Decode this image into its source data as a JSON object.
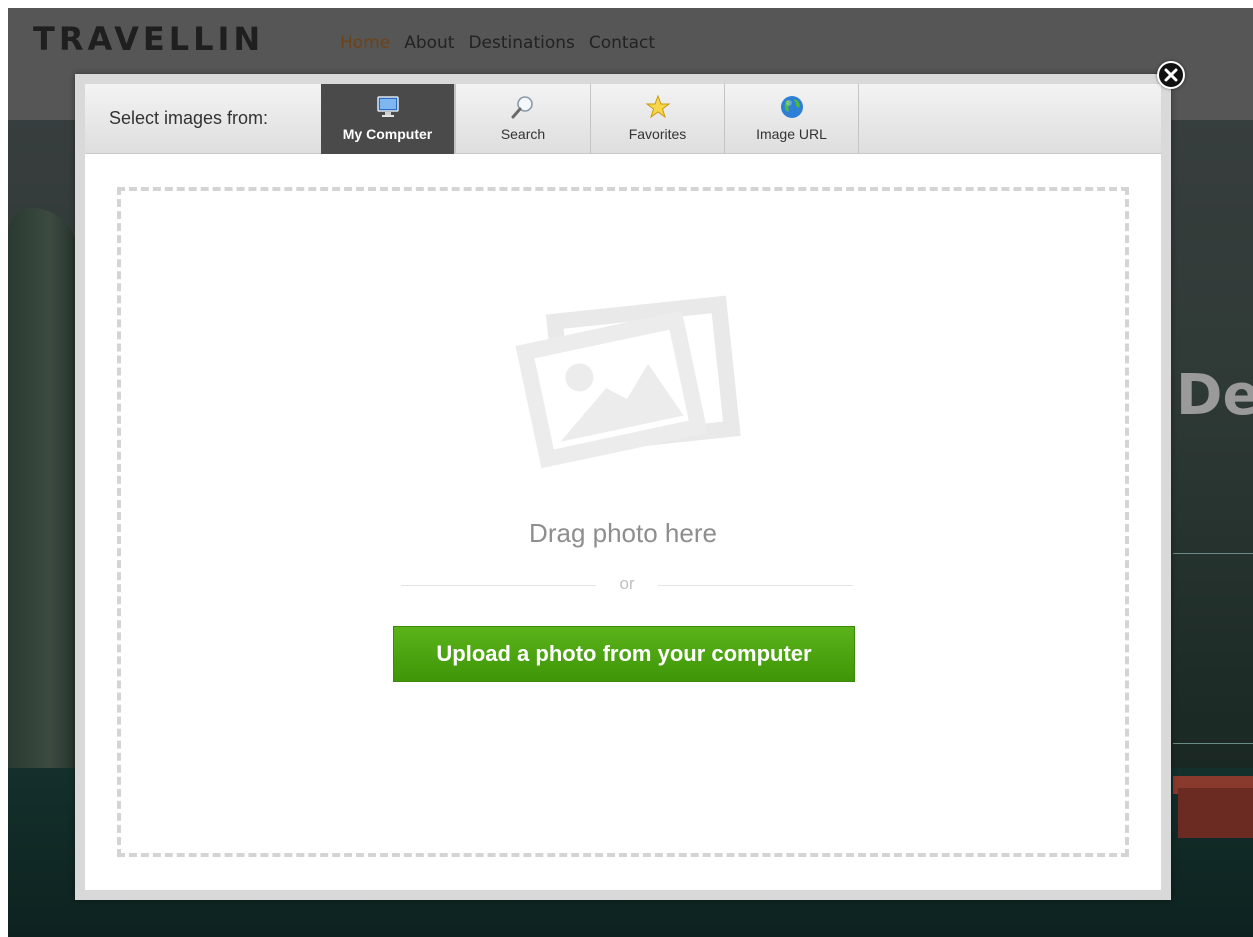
{
  "site": {
    "brand": "TRAVELLIN",
    "nav": [
      "Home",
      "About",
      "Destinations",
      "Contact"
    ],
    "active_nav": "Home",
    "hero_partial_text": "De"
  },
  "dialog": {
    "select_label": "Select images from:",
    "tabs": [
      {
        "label": "My Computer",
        "icon": "monitor-icon",
        "active": true
      },
      {
        "label": "Search",
        "icon": "magnifier-icon",
        "active": false
      },
      {
        "label": "Favorites",
        "icon": "star-icon",
        "active": false
      },
      {
        "label": "Image URL",
        "icon": "globe-icon",
        "active": false
      }
    ],
    "drag_text": "Drag photo here",
    "or_text": "or",
    "upload_button": "Upload a photo from your computer",
    "close_icon": "close-icon"
  },
  "colors": {
    "upload_green": "#4ca611",
    "active_tab": "#4a4a4a",
    "active_nav": "#6b4318"
  }
}
